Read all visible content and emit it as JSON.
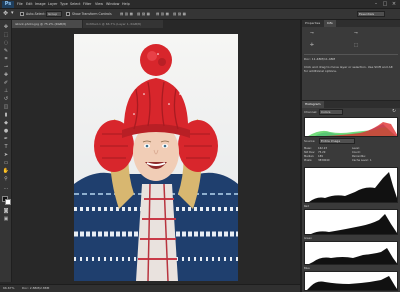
{
  "app": {
    "logo": "Ps"
  },
  "menu": {
    "items": [
      "File",
      "Edit",
      "Image",
      "Layer",
      "Type",
      "Select",
      "Filter",
      "View",
      "Window",
      "Help"
    ]
  },
  "window_controls": {
    "minimize": "–",
    "maximize": "□",
    "close": "×"
  },
  "options": {
    "auto_select_label": "Auto-Select:",
    "layer_dropdown": "Group",
    "show_transform_label": "Show Transform Controls",
    "workspace": "Essentials"
  },
  "tabs": {
    "doc1": "istock-photo.jpg @ 75.2% (RGB/8)",
    "doc2": "Untitled-1 @ 66.7% (Layer 1, RGB/8)"
  },
  "status": {
    "zoom": "66.67%",
    "doc_size": "Doc: 2.88M/2.88M"
  },
  "properties": {
    "tab_properties": "Properties",
    "tab_info": "Info",
    "doc_line": "Doc: 11.48M/11.48M",
    "hint": "Click and drag to move layer or selection. Use Shift and Alt for additional options."
  },
  "histogram": {
    "tab": "Histogram",
    "channel": "Channel:",
    "channel_value": "Colors",
    "source": "Source:",
    "source_value": "Entire Image",
    "mean_label": "Mean:",
    "mean": "162.23",
    "stddev_label": "Std Dev:",
    "stddev": "75.29",
    "median_label": "Median:",
    "median": "189",
    "pixels_label": "Pixels:",
    "pixels": "3839040",
    "level_label": "Level:",
    "count_label": "Count:",
    "percentile_label": "Percentile:",
    "cache_label": "Cache Level:",
    "cache": "1",
    "red_label": "Red",
    "green_label": "Green",
    "blue_label": "Blue"
  },
  "colors": {
    "accent": "#31a8ff",
    "panel": "#3a3a3a",
    "workspace": "#282828",
    "hat_red": "#d8262c"
  }
}
